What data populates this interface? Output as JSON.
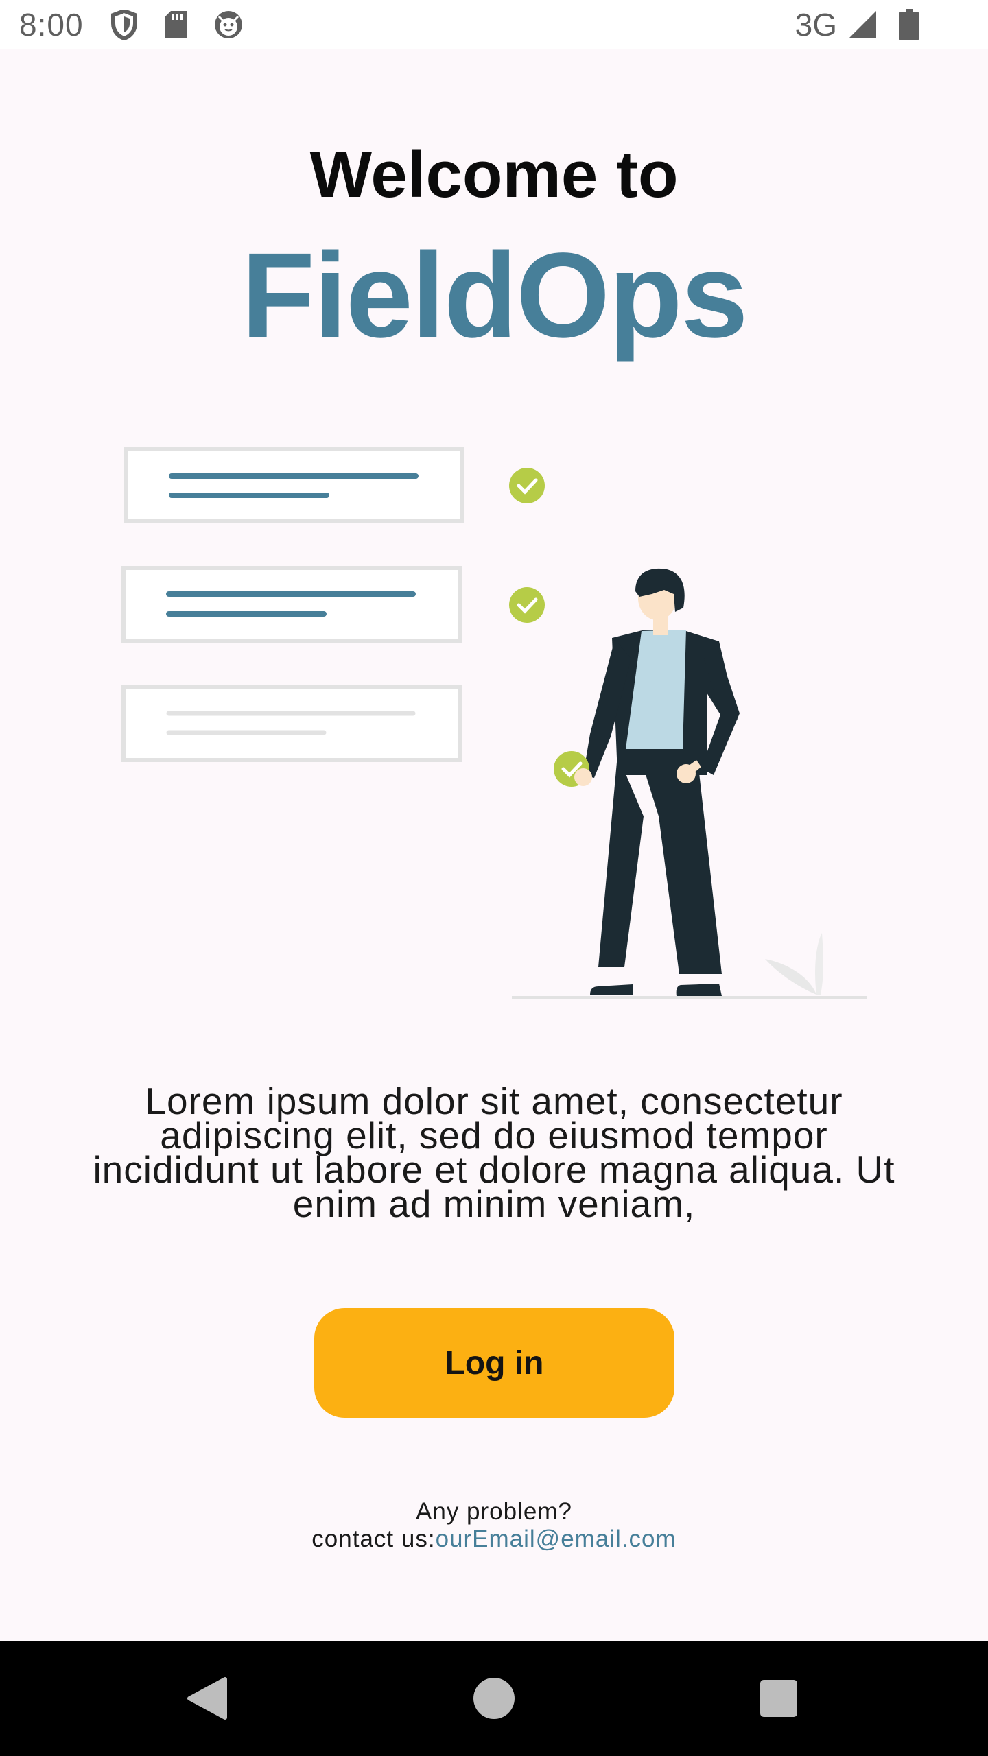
{
  "status_bar": {
    "time": "8:00",
    "network": "3G",
    "icons": [
      "shield-icon",
      "sd-card-icon",
      "notification-face-icon",
      "signal-icon",
      "battery-icon"
    ]
  },
  "header": {
    "welcome": "Welcome to",
    "brand": "FieldOps"
  },
  "illustration": {
    "description_icons": [
      "checklist-card-icon",
      "check-circle-icon",
      "person-figure",
      "plant-icon"
    ]
  },
  "body": {
    "description": "Lorem ipsum dolor sit amet, consectetur adipiscing elit, sed do eiusmod tempor incididunt ut labore et dolore magna aliqua. Ut enim ad minim veniam,"
  },
  "login": {
    "label": "Log in"
  },
  "contact": {
    "problem": "Any problem?",
    "prefix": "contact us:",
    "email": "ourEmail@email.com"
  },
  "nav": {
    "icons": [
      "back-icon",
      "home-icon",
      "recents-icon"
    ]
  },
  "colors": {
    "brand": "#477f99",
    "accent": "#fcb012",
    "check": "#b6cc47",
    "background": "#fdf8fb"
  }
}
